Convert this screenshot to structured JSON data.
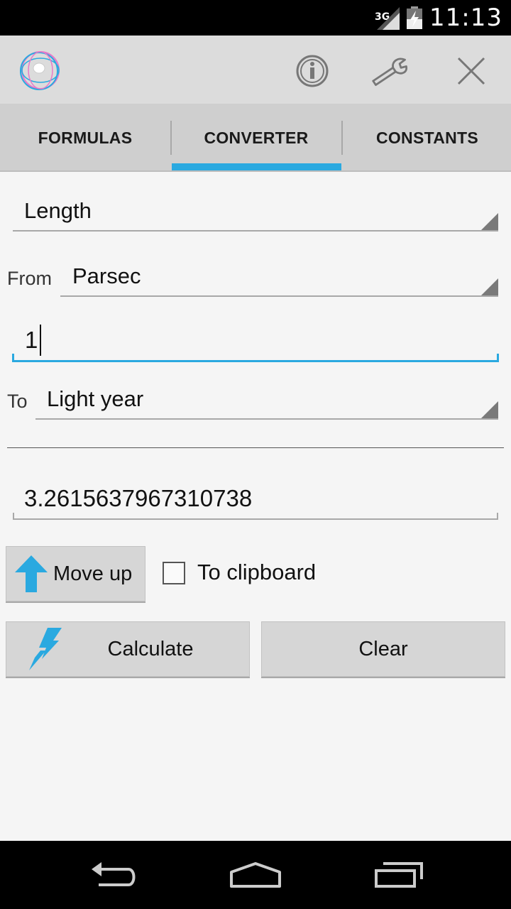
{
  "status_bar": {
    "network_type": "3G",
    "time": "11:13",
    "icons": [
      "signal-icon",
      "battery-charging-icon"
    ]
  },
  "action_bar": {
    "icons": [
      "app-logo-icon",
      "info-icon",
      "wrench-icon",
      "close-icon"
    ]
  },
  "tabs": [
    {
      "label": "FORMULAS",
      "selected": false
    },
    {
      "label": "CONVERTER",
      "selected": true
    },
    {
      "label": "CONSTANTS",
      "selected": false
    }
  ],
  "converter": {
    "category": "Length",
    "from_label": "From",
    "from_unit": "Parsec",
    "input_value": "1",
    "to_label": "To",
    "to_unit": "Light year",
    "result": "3.2615637967310738"
  },
  "buttons": {
    "move_up": "Move up",
    "to_clipboard": "To clipboard",
    "to_clipboard_checked": false,
    "calculate": "Calculate",
    "clear": "Clear"
  },
  "nav_bar": {
    "icons": [
      "back-icon",
      "home-icon",
      "recents-icon"
    ]
  },
  "colors": {
    "accent": "#2aa9e0",
    "action_bar": "#dcdcdc",
    "tab_bar": "#cfcfcf",
    "background": "#f5f5f5"
  }
}
